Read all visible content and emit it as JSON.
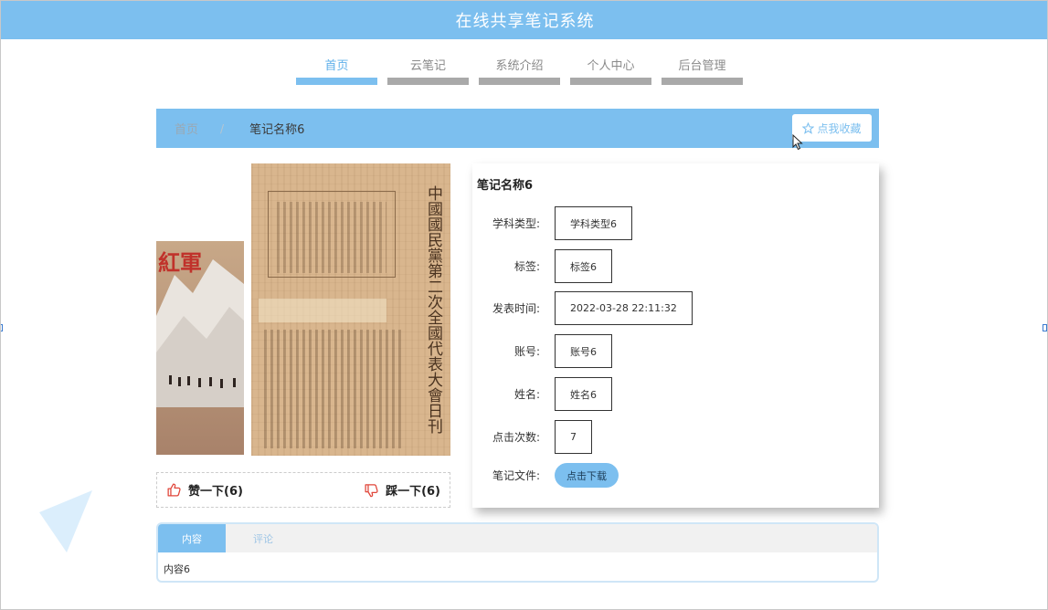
{
  "header": {
    "title": "在线共享笔记系统"
  },
  "nav": {
    "items": [
      {
        "label": "首页",
        "active": true
      },
      {
        "label": "云笔记",
        "active": false
      },
      {
        "label": "系统介绍",
        "active": false
      },
      {
        "label": "个人中心",
        "active": false
      },
      {
        "label": "后台管理",
        "active": false
      }
    ]
  },
  "breadcrumb": {
    "home": "首页",
    "separator": "/",
    "current": "笔记名称6",
    "favorite_label": "点我收藏"
  },
  "gallery": {
    "book1_title": "紅軍",
    "book2_headline": "中國國民黨第二次全國代表大會日刊"
  },
  "vote": {
    "like_label": "赞一下(6)",
    "dislike_label": "踩一下(6)"
  },
  "detail": {
    "name": "笔记名称6",
    "fields": {
      "subject_type": {
        "label": "学科类型:",
        "value": "学科类型6"
      },
      "tag": {
        "label": "标签:",
        "value": "标签6"
      },
      "publish_time": {
        "label": "发表时间:",
        "value": "2022-03-28 22:11:32"
      },
      "account": {
        "label": "账号:",
        "value": "账号6"
      },
      "name": {
        "label": "姓名:",
        "value": "姓名6"
      },
      "clicks": {
        "label": "点击次数:",
        "value": "7"
      },
      "file": {
        "label": "笔记文件:",
        "button": "点击下载"
      }
    }
  },
  "tabs": {
    "items": [
      {
        "label": "内容",
        "active": true
      },
      {
        "label": "评论",
        "active": false
      }
    ],
    "content": "内容6"
  },
  "colors": {
    "primary": "#7cbfef",
    "nav_inactive_bar": "#a9a9a9",
    "like": "#e0463a"
  }
}
